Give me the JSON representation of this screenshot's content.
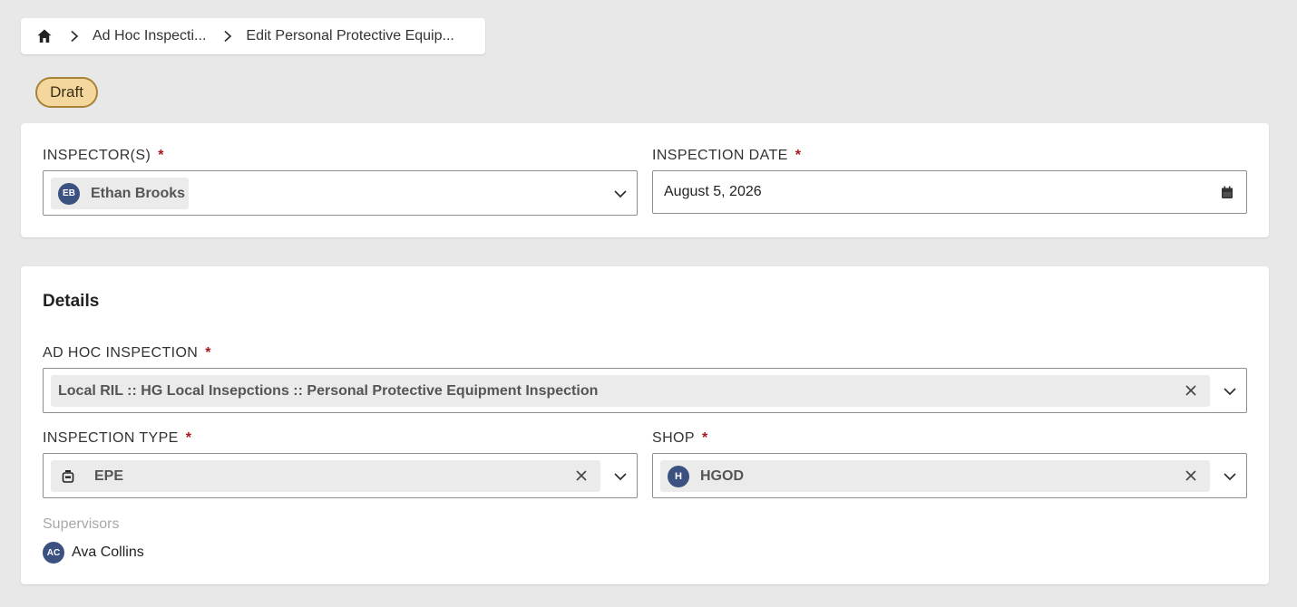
{
  "breadcrumb": {
    "items": [
      "Ad Hoc Inspecti...",
      "Edit Personal Protective Equip..."
    ]
  },
  "status": {
    "label": "Draft",
    "color": "#f4d79c"
  },
  "inspectors": {
    "label": "INSPECTOR(S)",
    "required_mark": "*",
    "selected": {
      "initials": "EB",
      "name": "Ethan Brooks"
    }
  },
  "inspection_date": {
    "label": "INSPECTION DATE",
    "required_mark": "*",
    "value": "August 5, 2026"
  },
  "details": {
    "title": "Details",
    "ad_hoc": {
      "label": "AD HOC INSPECTION",
      "required_mark": "*",
      "value": "Local RIL :: HG Local Insepctions :: Personal Protective Equipment Inspection"
    },
    "inspection_type": {
      "label": "INSPECTION TYPE",
      "required_mark": "*",
      "value": "EPE"
    },
    "shop": {
      "label": "SHOP",
      "required_mark": "*",
      "initials": "H",
      "value": "HGOD"
    },
    "supervisors": {
      "label": "Supervisors",
      "items": [
        {
          "initials": "AC",
          "name": "Ava Collins"
        }
      ]
    }
  },
  "colors": {
    "accent_avatar": "#3b5180",
    "required": "#a3191e",
    "background": "#e8e8e8"
  }
}
